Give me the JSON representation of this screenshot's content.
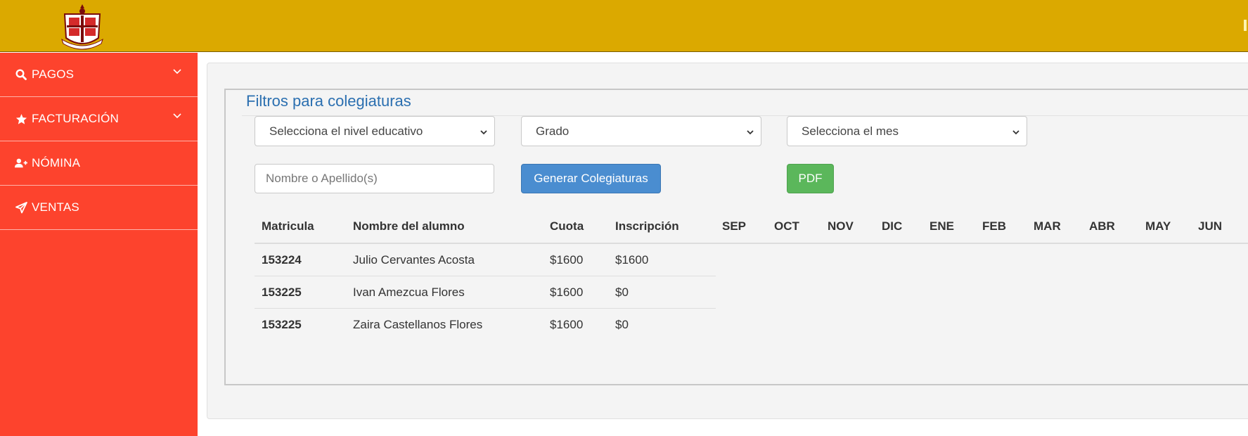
{
  "colors": {
    "topbar": "#dba900",
    "sidebar": "#fd432d",
    "legend": "#2b6fb0",
    "primary_button": "#4a8dd0",
    "success_button": "#5bb75b"
  },
  "sidebar": {
    "items": [
      {
        "label": "PAGOS",
        "icon": "search-icon",
        "has_submenu": true
      },
      {
        "label": "FACTURACIÓN",
        "icon": "star-icon",
        "has_submenu": true
      },
      {
        "label": "NÓMINA",
        "icon": "user-plus-icon",
        "has_submenu": false
      },
      {
        "label": "VENTAS",
        "icon": "paper-plane-icon",
        "has_submenu": false
      }
    ]
  },
  "filters": {
    "title": "Filtros para colegiaturas",
    "level_select": "Selecciona el nivel educativo",
    "grade_select": "Grado",
    "month_select": "Selecciona el mes",
    "name_placeholder": "Nombre o Apellido(s)",
    "generate_label": "Generar Colegiaturas",
    "pdf_label": "PDF"
  },
  "table": {
    "headers": [
      "Matricula",
      "Nombre del alumno",
      "Cuota",
      "Inscripción",
      "SEP",
      "OCT",
      "NOV",
      "DIC",
      "ENE",
      "FEB",
      "MAR",
      "ABR",
      "MAY",
      "JUN"
    ],
    "rows": [
      {
        "matricula": "153224",
        "nombre": "Julio Cervantes Acosta",
        "cuota": "$1600",
        "inscripcion": "$1600"
      },
      {
        "matricula": "153225",
        "nombre": "Ivan Amezcua Flores",
        "cuota": "$1600",
        "inscripcion": "$0"
      },
      {
        "matricula": "153225",
        "nombre": "Zaira Castellanos Flores",
        "cuota": "$1600",
        "inscripcion": "$0"
      }
    ]
  }
}
